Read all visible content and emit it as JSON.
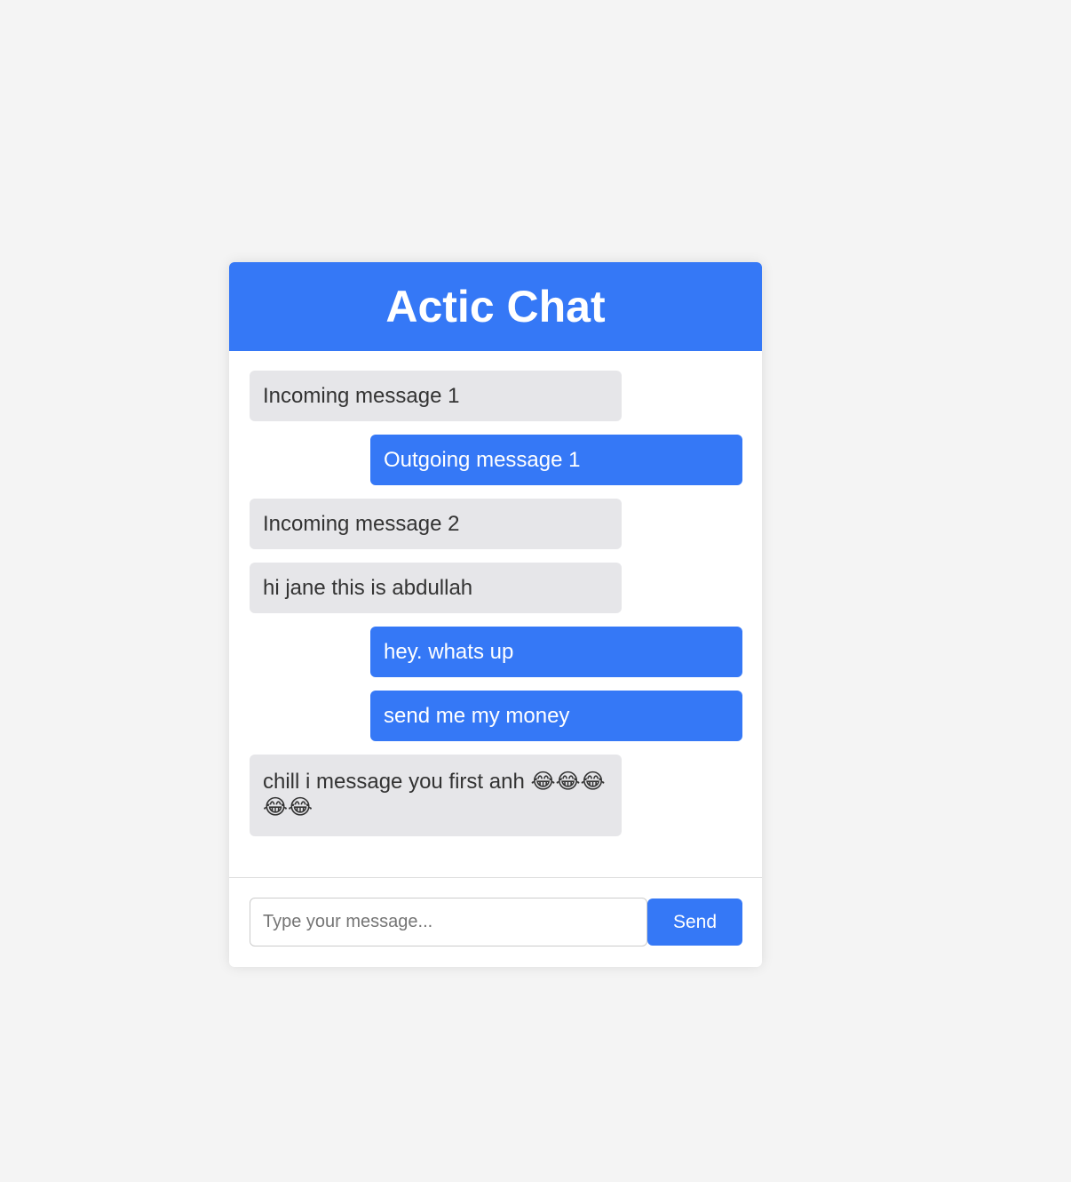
{
  "header": {
    "title": "Actic Chat"
  },
  "messages": [
    {
      "direction": "incoming",
      "text": "Incoming message 1"
    },
    {
      "direction": "outgoing",
      "text": "Outgoing message 1"
    },
    {
      "direction": "incoming",
      "text": "Incoming message 2"
    },
    {
      "direction": "incoming",
      "text": "hi jane this is abdullah"
    },
    {
      "direction": "outgoing",
      "text": "hey. whats up"
    },
    {
      "direction": "outgoing",
      "text": "send me my money"
    },
    {
      "direction": "incoming",
      "text": "chill i message you first anh 😂😂😂😂😂"
    }
  ],
  "composer": {
    "value": "",
    "placeholder": "Type your message...",
    "send_label": "Send"
  },
  "colors": {
    "accent": "#3578f6",
    "incoming_bubble": "#e6e6e9",
    "page_background": "#f4f4f4"
  }
}
